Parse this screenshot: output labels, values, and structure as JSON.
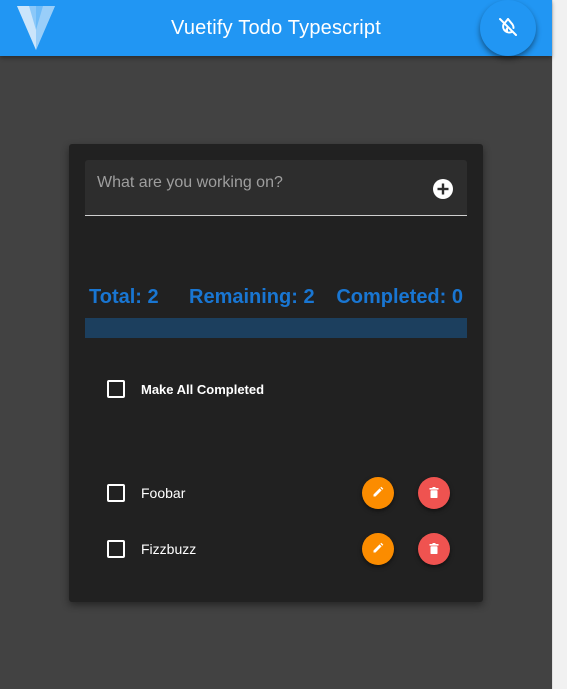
{
  "app_bar": {
    "title": "Vuetify Todo Typescript",
    "logo_icon": "vuetify-logo",
    "theme_toggle_icon": "invert-colors-off-icon",
    "color": "#2196f3"
  },
  "todo_form": {
    "placeholder": "What are you working on?",
    "value": "",
    "add_icon": "plus-circle-icon"
  },
  "stats": {
    "total": "Total: 2",
    "remaining": "Remaining: 2",
    "completed": "Completed: 0",
    "color": "#1976d2"
  },
  "progress": {
    "completed_fraction": 0
  },
  "make_all": {
    "label": "Make All Completed",
    "checked": false
  },
  "todos": [
    {
      "text": "Foobar",
      "checked": false,
      "edit_icon": "pencil-icon",
      "delete_icon": "trash-icon"
    },
    {
      "text": "Fizzbuzz",
      "checked": false,
      "edit_icon": "pencil-icon",
      "delete_icon": "trash-icon"
    }
  ],
  "colors": {
    "background": "#424242",
    "card": "#212121",
    "edit_button": "#fb8c00",
    "delete_button": "#ef5350"
  }
}
